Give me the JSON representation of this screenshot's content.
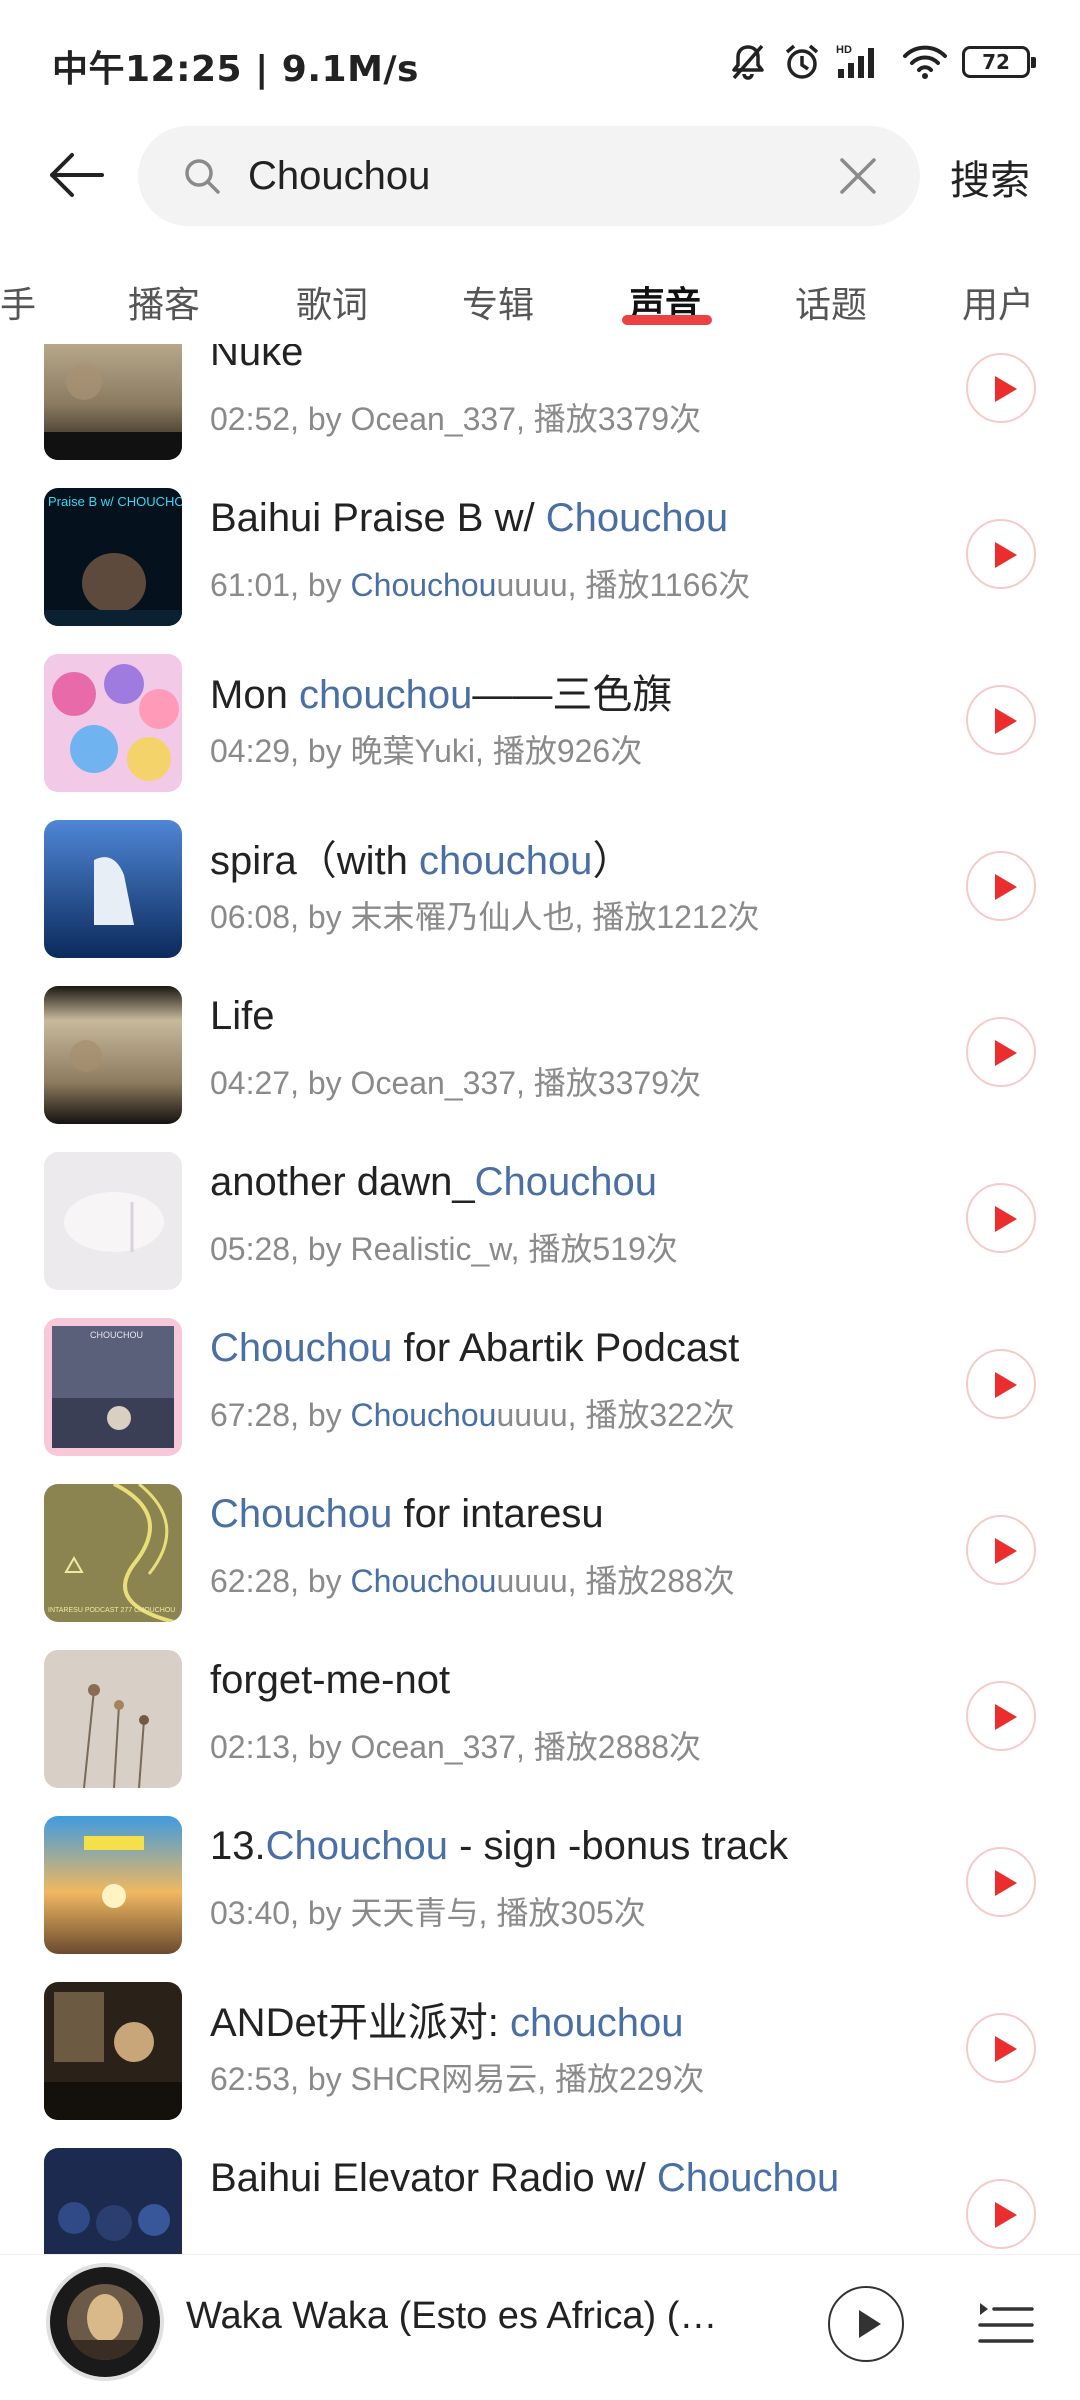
{
  "status_bar": {
    "time_speed": "中午12:25 | 9.1M/s",
    "signal_label": "HD",
    "battery": "72"
  },
  "search": {
    "query": "Chouchou",
    "submit_label": "搜索"
  },
  "tabs": [
    {
      "label": "手",
      "active": false
    },
    {
      "label": "播客",
      "active": false
    },
    {
      "label": "歌词",
      "active": false
    },
    {
      "label": "专辑",
      "active": false
    },
    {
      "label": "声音",
      "active": true
    },
    {
      "label": "话题",
      "active": false
    },
    {
      "label": "用户",
      "active": false
    }
  ],
  "results": [
    {
      "title": [
        "Nuke"
      ],
      "meta": [
        "02:52, by Ocean_337, 播放3379次"
      ]
    },
    {
      "title": [
        "Baihui Praise B w/ ",
        "Chouchou"
      ],
      "meta": [
        "61:01, by ",
        "Chouchou",
        "uuuu, 播放1166次"
      ]
    },
    {
      "title": [
        "Mon ",
        "chouchou",
        "——三色旗"
      ],
      "meta": [
        "04:29, by 晚葉Yuki, 播放926次"
      ]
    },
    {
      "title": [
        "spira（with ",
        "chouchou",
        "）"
      ],
      "meta": [
        "06:08, by 末末罹乃仙人也, 播放1212次"
      ]
    },
    {
      "title": [
        "Life"
      ],
      "meta": [
        "04:27, by Ocean_337, 播放3379次"
      ]
    },
    {
      "title": [
        "another dawn_",
        "Chouchou"
      ],
      "meta": [
        "05:28, by Realistic_w, 播放519次"
      ]
    },
    {
      "title": [
        "",
        "Chouchou",
        " for Abartik Podcast"
      ],
      "meta": [
        "67:28, by ",
        "Chouchou",
        "uuuu, 播放322次"
      ]
    },
    {
      "title": [
        "",
        "Chouchou",
        " for intaresu"
      ],
      "meta": [
        "62:28, by ",
        "Chouchou",
        "uuuu, 播放288次"
      ]
    },
    {
      "title": [
        "forget-me-not"
      ],
      "meta": [
        "02:13, by Ocean_337, 播放2888次"
      ]
    },
    {
      "title": [
        "13.",
        "Chouchou",
        " - sign -bonus track"
      ],
      "meta": [
        "03:40, by 天天青与, 播放305次"
      ]
    },
    {
      "title": [
        "ANDet开业派对: ",
        "chouchou"
      ],
      "meta": [
        "62:53, by SHCR网易云, 播放229次"
      ]
    },
    {
      "title": [
        "Baihui Elevator Radio w/ ",
        "Chouchou"
      ],
      "meta": [
        ""
      ]
    }
  ],
  "thumb_art_text": {
    "baihui": "Praise B w/ CHOUCHOU",
    "abartik": "CHOUCHOU",
    "intaresu": "INTARESU PODCAST 277 CHOUCHOU"
  },
  "player": {
    "title": "Waka Waka (Esto es Africa) (…"
  },
  "colors": {
    "accent": "#ec4141",
    "highlight": "#4a6fa5",
    "meta_text": "#8a8a8a"
  },
  "icons": {
    "back": "arrow-left-icon",
    "search": "search-icon",
    "clear": "close-icon",
    "play": "play-icon",
    "playlist": "playlist-icon"
  }
}
